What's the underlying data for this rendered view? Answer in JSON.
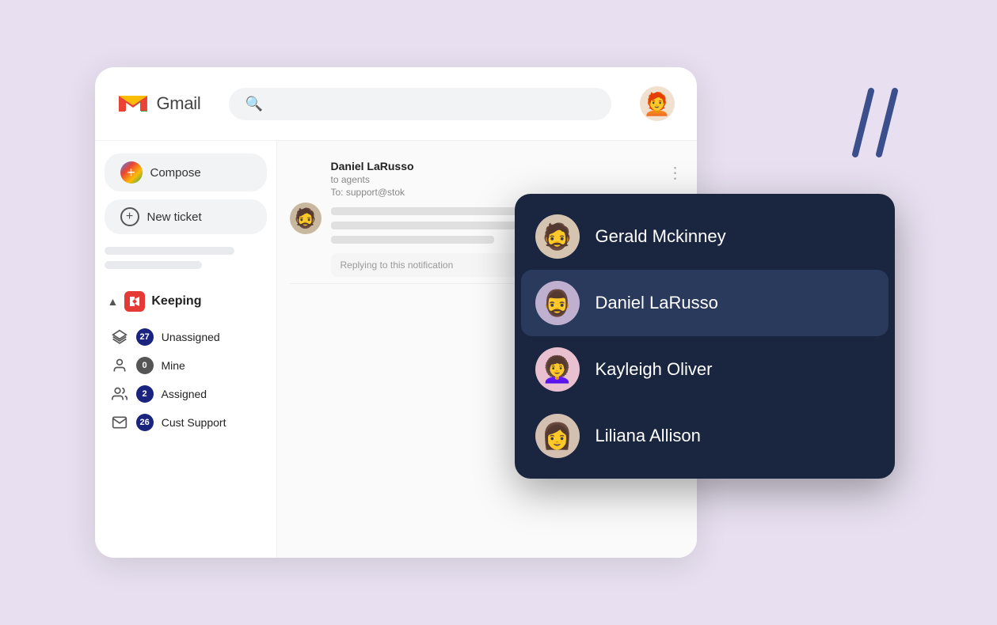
{
  "header": {
    "gmail_title": "Gmail",
    "search_placeholder": ""
  },
  "sidebar": {
    "compose_label": "Compose",
    "new_ticket_label": "New ticket",
    "keeping_section": {
      "label": "Keeping",
      "logo_text": "K",
      "items": [
        {
          "id": "unassigned",
          "label": "Unassigned",
          "badge": "27",
          "icon": "layers"
        },
        {
          "id": "mine",
          "label": "Mine",
          "badge": "0",
          "icon": "person"
        },
        {
          "id": "assigned",
          "label": "Assigned",
          "badge": "2",
          "icon": "people"
        },
        {
          "id": "cust-support",
          "label": "Cust Support",
          "badge": "26",
          "icon": "mail"
        }
      ]
    }
  },
  "email": {
    "from": "Daniel LaRusso",
    "to_label": "to agents",
    "address": "To: support@stok",
    "reply_text": "Replying to this notification"
  },
  "dropdown": {
    "title": "agent-selector",
    "items": [
      {
        "id": "gerald",
        "name": "Gerald Mckinney",
        "emoji": "🧔",
        "selected": false,
        "bg": "#d4c4b0"
      },
      {
        "id": "daniel",
        "name": "Daniel LaRusso",
        "emoji": "🧔‍♂️",
        "selected": true,
        "bg": "#c0b8d0"
      },
      {
        "id": "kayleigh",
        "name": "Kayleigh Oliver",
        "emoji": "👩‍🦱",
        "selected": false,
        "bg": "#e8c0d0"
      },
      {
        "id": "liliana",
        "name": "Liliana Allison",
        "emoji": "👩",
        "selected": false,
        "bg": "#d4c0b0"
      }
    ]
  },
  "decorative": {
    "slash1": "/",
    "slash2": "/"
  }
}
